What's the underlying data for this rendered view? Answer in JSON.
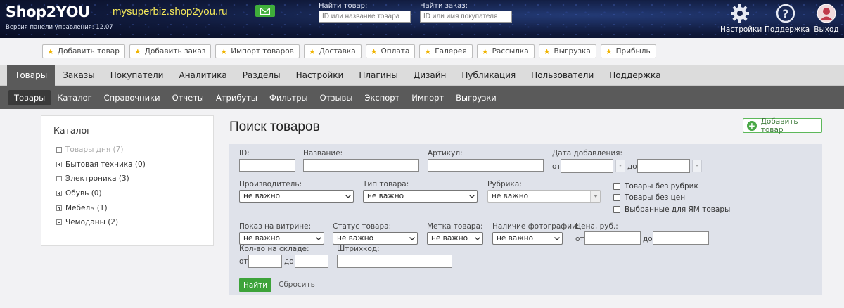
{
  "header": {
    "logo": "Shop2YOU",
    "version": "Версия панели управления: 12.07",
    "site_url": "mysuperbiz.shop2you.ru",
    "mail_icon": "envelope-icon",
    "search_product": {
      "label": "Найти товар:",
      "placeholder": "ID или название товара"
    },
    "search_order": {
      "label": "Найти заказ:",
      "placeholder": "ID или имя покупателя"
    },
    "settings_label": "Настройки",
    "support_label": "Поддержка",
    "logout_label": "Выход"
  },
  "quickbar": [
    "Добавить товар",
    "Добавить заказ",
    "Импорт товаров",
    "Доставка",
    "Оплата",
    "Галерея",
    "Рассылка",
    "Выгрузка",
    "Прибыль"
  ],
  "main_nav": [
    "Товары",
    "Заказы",
    "Покупатели",
    "Аналитика",
    "Разделы",
    "Настройки",
    "Плагины",
    "Дизайн",
    "Публикация",
    "Пользователи",
    "Поддержка"
  ],
  "sub_nav": [
    "Товары",
    "Каталог",
    "Справочники",
    "Отчеты",
    "Атрибуты",
    "Фильтры",
    "Отзывы",
    "Экспорт",
    "Импорт",
    "Выгрузки"
  ],
  "sidebar": {
    "title": "Каталог",
    "items": [
      {
        "label": "Товары дня",
        "count": "(7)"
      },
      {
        "label": "Бытовая техника",
        "count": "(0)"
      },
      {
        "label": "Электроника",
        "count": "(3)"
      },
      {
        "label": "Обувь",
        "count": "(0)"
      },
      {
        "label": "Мебель",
        "count": "(1)"
      },
      {
        "label": "Чемоданы",
        "count": "(2)"
      }
    ]
  },
  "main": {
    "title": "Поиск товаров",
    "add_button": "Добавить товар"
  },
  "filter": {
    "id_label": "ID:",
    "name_label": "Название:",
    "sku_label": "Артикул:",
    "date_label": "Дата добавления:",
    "from": "от",
    "to": "до",
    "dash": "-",
    "manufacturer_label": "Производитель:",
    "type_label": "Тип товара:",
    "category_label": "Рубрика:",
    "any": "не важно",
    "chk_no_category": "Товары без рубрик",
    "chk_no_price": "Товары без цен",
    "chk_ym": "Выбранные для ЯМ товары",
    "showcase_label": "Показ на витрине:",
    "status_label": "Статус товара:",
    "tag_label": "Метка товара:",
    "photo_label": "Наличие фотографии:",
    "price_label": "Цена, руб.:",
    "stock_label": "Кол-во на складе:",
    "barcode_label": "Штрихкод:",
    "find_button": "Найти",
    "reset_link": "Сбросить"
  }
}
